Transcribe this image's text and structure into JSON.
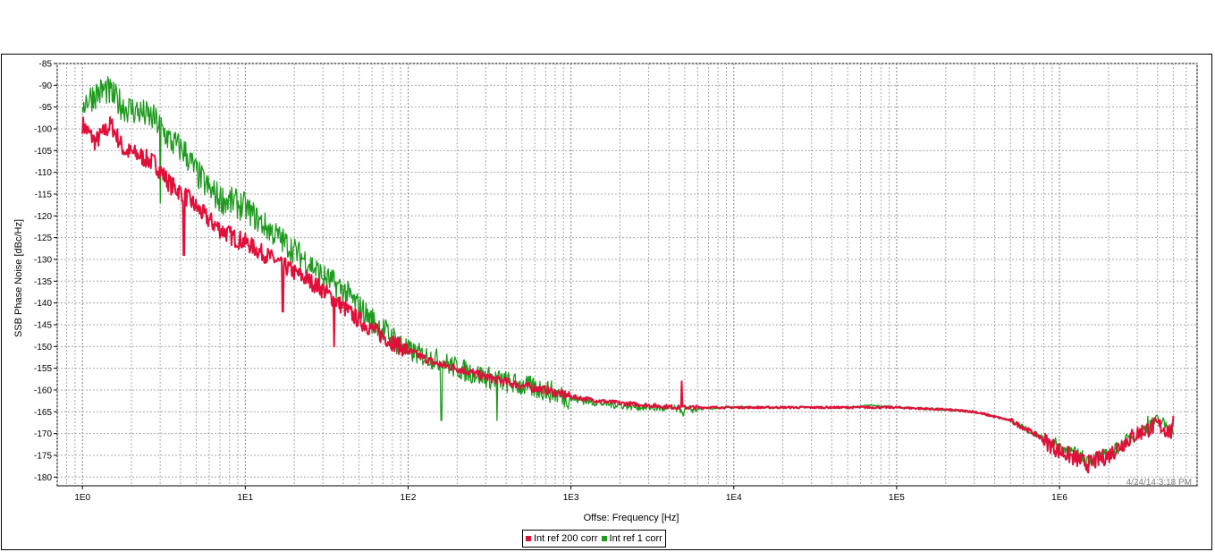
{
  "chart_data": {
    "type": "line",
    "xlabel": "Offse: Frequency [Hz]",
    "ylabel": "SSB Phase Noise [dBc/Hz]",
    "x_scale": "log",
    "xlim": [
      0.7,
      7000000
    ],
    "ylim": [
      -182,
      -85
    ],
    "x_ticks": [
      {
        "value": 1,
        "label": "1E0"
      },
      {
        "value": 10,
        "label": "1E1"
      },
      {
        "value": 100,
        "label": "1E2"
      },
      {
        "value": 1000,
        "label": "1E3"
      },
      {
        "value": 10000,
        "label": "1E4"
      },
      {
        "value": 100000,
        "label": "1E5"
      },
      {
        "value": 1000000,
        "label": "1E6"
      }
    ],
    "y_ticks": [
      -85,
      -90,
      -95,
      -100,
      -105,
      -110,
      -115,
      -120,
      -125,
      -130,
      -135,
      -140,
      -145,
      -150,
      -155,
      -160,
      -165,
      -170,
      -175,
      -180
    ],
    "grid": true,
    "legend_position": "bottom-center",
    "timestamp": "4/24/14 3:18 PM",
    "series": [
      {
        "name": "Int ref 200 corr",
        "color": "#e0103a",
        "points": [
          [
            1,
            -99
          ],
          [
            1.2,
            -103
          ],
          [
            1.5,
            -99
          ],
          [
            1.8,
            -105
          ],
          [
            2.2,
            -106
          ],
          [
            2.8,
            -108
          ],
          [
            3.5,
            -113
          ],
          [
            4.2,
            -115
          ],
          [
            5,
            -118
          ],
          [
            6,
            -121
          ],
          [
            7,
            -123
          ],
          [
            8.5,
            -125
          ],
          [
            10,
            -126
          ],
          [
            12,
            -128
          ],
          [
            15,
            -130
          ],
          [
            20,
            -133
          ],
          [
            25,
            -135
          ],
          [
            30,
            -137
          ],
          [
            40,
            -141
          ],
          [
            50,
            -144
          ],
          [
            60,
            -146
          ],
          [
            80,
            -149
          ],
          [
            100,
            -151
          ],
          [
            150,
            -154
          ],
          [
            200,
            -155
          ],
          [
            300,
            -157
          ],
          [
            500,
            -159
          ],
          [
            700,
            -160
          ],
          [
            1000,
            -161.5
          ],
          [
            1500,
            -162.5
          ],
          [
            2000,
            -163
          ],
          [
            3000,
            -163.5
          ],
          [
            4500,
            -164
          ],
          [
            7000,
            -164
          ],
          [
            10000,
            -164
          ],
          [
            20000,
            -164
          ],
          [
            50000,
            -164
          ],
          [
            100000,
            -164
          ],
          [
            200000,
            -164.5
          ],
          [
            300000,
            -165
          ],
          [
            500000,
            -167
          ],
          [
            700000,
            -170
          ],
          [
            1000000,
            -174
          ],
          [
            1300000,
            -176
          ],
          [
            1500000,
            -177
          ],
          [
            2000000,
            -175
          ],
          [
            2500000,
            -172
          ],
          [
            3000000,
            -170
          ],
          [
            4000000,
            -168
          ],
          [
            5000000,
            -170
          ]
        ],
        "noise_events": [
          [
            4.2,
            -129
          ],
          [
            17,
            -142
          ],
          [
            35,
            -150
          ],
          [
            4800,
            -158
          ],
          [
            5000000,
            -166
          ]
        ]
      },
      {
        "name": "Int ref 1 corr",
        "color": "#1e9a1e",
        "points": [
          [
            1,
            -94
          ],
          [
            1.2,
            -92
          ],
          [
            1.4,
            -91
          ],
          [
            1.8,
            -95
          ],
          [
            2.2,
            -96
          ],
          [
            2.8,
            -98
          ],
          [
            3.5,
            -103
          ],
          [
            4.2,
            -105
          ],
          [
            5,
            -110
          ],
          [
            6,
            -114
          ],
          [
            7,
            -116
          ],
          [
            8.5,
            -117
          ],
          [
            10,
            -118
          ],
          [
            12,
            -121
          ],
          [
            15,
            -124
          ],
          [
            20,
            -128
          ],
          [
            25,
            -131
          ],
          [
            30,
            -134
          ],
          [
            40,
            -137
          ],
          [
            50,
            -141
          ],
          [
            60,
            -144
          ],
          [
            80,
            -148
          ],
          [
            100,
            -151
          ],
          [
            150,
            -153
          ],
          [
            200,
            -155
          ],
          [
            300,
            -157
          ],
          [
            500,
            -159
          ],
          [
            700,
            -160
          ],
          [
            1000,
            -162
          ],
          [
            1500,
            -163
          ],
          [
            2000,
            -163.5
          ],
          [
            3000,
            -164
          ],
          [
            5000,
            -164.5
          ],
          [
            10000,
            -164
          ],
          [
            50000,
            -164
          ],
          [
            70000,
            -163.5
          ],
          [
            100000,
            -164
          ],
          [
            200000,
            -164.5
          ],
          [
            300000,
            -165
          ],
          [
            500000,
            -167
          ],
          [
            700000,
            -170
          ],
          [
            1000000,
            -173
          ],
          [
            1300000,
            -175
          ],
          [
            1500000,
            -176
          ],
          [
            2000000,
            -175
          ],
          [
            2500000,
            -172
          ],
          [
            3000000,
            -170
          ],
          [
            4000000,
            -167
          ],
          [
            5000000,
            -169
          ]
        ],
        "noise_events": [
          [
            3,
            -117
          ],
          [
            160,
            -167
          ],
          [
            350,
            -167
          ],
          [
            4900,
            -166
          ],
          [
            3500000,
            -166
          ]
        ]
      }
    ]
  }
}
